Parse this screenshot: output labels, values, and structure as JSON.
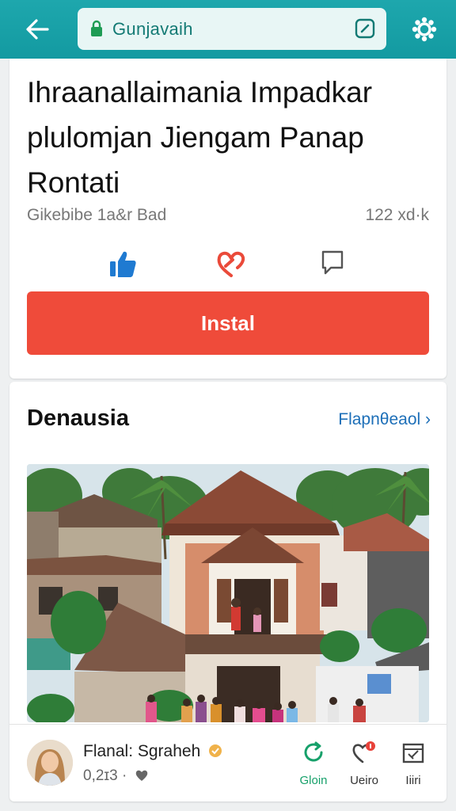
{
  "header": {
    "url_text": "Gunjavaih",
    "back_icon": "arrow-left-icon",
    "lock_icon": "lock-icon",
    "edit_icon": "edit-icon",
    "settings_icon": "gear-icon",
    "accent": "#1ea7ad"
  },
  "app": {
    "title": "Ihraanallaimania Impadkar plulomjan Jiengam Panap Rontati",
    "meta_left": "Gikebibe 1a&r Bad",
    "meta_right": "122 xd·k",
    "actions": [
      {
        "icon": "thumbs-up-icon",
        "color": "#1f7ad1"
      },
      {
        "icon": "heart-icon",
        "color": "#ea4a3a"
      },
      {
        "icon": "comment-icon",
        "color": "#555555"
      }
    ],
    "install_label": "Instal",
    "install_color": "#ef4b3a"
  },
  "section": {
    "title": "Denausia",
    "see_more": "Flapnθeaol ›"
  },
  "author": {
    "name": "Flanal: Sgraheh",
    "count": "0,2ɪ3 ·",
    "verified_icon": "badge-icon",
    "heart_icon": "heart-icon"
  },
  "footer_actions": [
    {
      "label": "Gloin",
      "icon": "refresh-icon",
      "color": "#16a06a"
    },
    {
      "label": "Ueiro",
      "icon": "heart-icon",
      "color": "#444444"
    },
    {
      "label": "Iiiri",
      "icon": "frame-icon",
      "color": "#444444"
    }
  ]
}
